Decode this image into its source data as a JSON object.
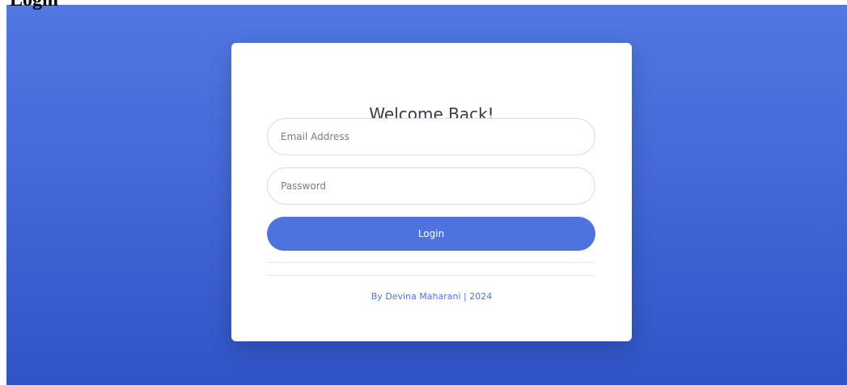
{
  "document": {
    "heading": "Login"
  },
  "card": {
    "title": "Welcome Back!",
    "email_placeholder": "Email Address",
    "password_placeholder": "Password",
    "login_label": "Login",
    "credit": "By Devina Maharani | 2024"
  },
  "colors": {
    "background_top": "#5078e0",
    "background_bottom": "#2f54c6",
    "button": "#4e73df",
    "credit_text": "#4e73df",
    "title_text": "#3a3b45"
  }
}
